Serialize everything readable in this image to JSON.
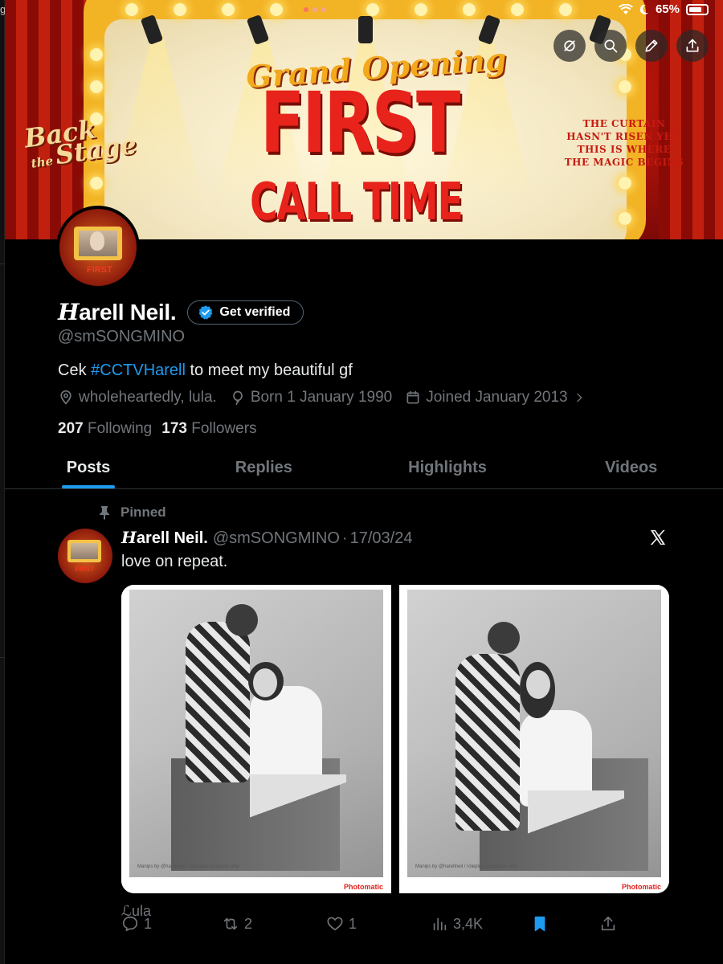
{
  "status_bar": {
    "left_fragment": "g",
    "battery": "65%"
  },
  "banner": {
    "grand_opening": "Grand Opening",
    "first": "FIRST",
    "call_time": "CALL TIME",
    "back_top": "Back",
    "back_the": "the",
    "back_stage": "Stage",
    "curtain_text": "THE CURTAIN HASN'T RISEN YET. THIS IS WHERE THE MAGIC BEGINS"
  },
  "top_actions": {
    "icons": [
      "grok-icon",
      "search-icon",
      "edit-icon",
      "share-icon"
    ]
  },
  "profile": {
    "name": "Harell Neil.",
    "name_initial": "H",
    "name_rest": "arell Neil.",
    "verify_label": "Get verified",
    "handle": "@smSONGMINO",
    "bio_prefix": "Cek ",
    "bio_hashtag": "#CCTVHarell",
    "bio_suffix": " to meet my beautiful gf",
    "location": "wholeheartedly, lula.",
    "born": "Born 1 January 1990",
    "joined": "Joined January 2013",
    "following_count": "207",
    "following_label": "Following",
    "followers_count": "173",
    "followers_label": "Followers"
  },
  "tabs": [
    {
      "label": "Posts",
      "active": true
    },
    {
      "label": "Replies",
      "active": false
    },
    {
      "label": "Highlights",
      "active": false
    },
    {
      "label": "Videos",
      "active": false
    }
  ],
  "post": {
    "pinned_label": "Pinned",
    "author_initial": "H",
    "author_rest": "arell Neil.",
    "handle": "@smSONGMINO",
    "sep": "·",
    "date": "17/03/24",
    "text": "love on repeat.",
    "photo_credit": "Manips by @harellneil / roleplayer purpose only",
    "photo_brand": "Photomatic",
    "signoff": "ℒula",
    "replies": "1",
    "reposts": "2",
    "likes": "1",
    "views": "3,4K"
  },
  "colors": {
    "accent": "#1d9bf0",
    "muted": "#71767b",
    "text": "#e7e9ea",
    "bg": "#000000"
  }
}
